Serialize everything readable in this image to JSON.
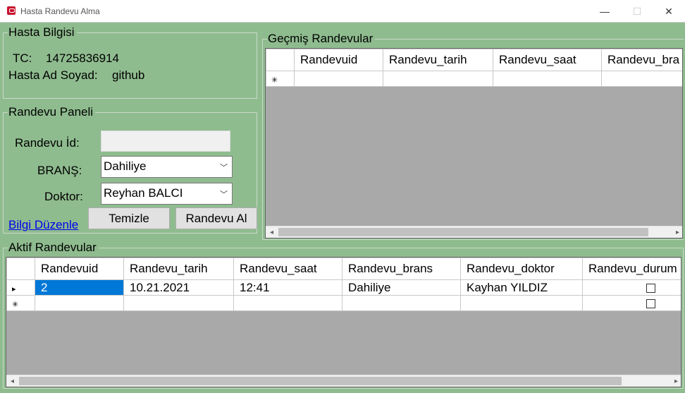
{
  "window": {
    "title": "Hasta Randevu Alma",
    "minimize": "—",
    "maximize": "☐",
    "close": "✕"
  },
  "patient_info": {
    "group_title": "Hasta Bilgisi",
    "tc_label": "TC:",
    "tc_value": "14725836914",
    "name_label": "Hasta Ad Soyad:",
    "name_value": "github"
  },
  "appointment_panel": {
    "group_title": "Randevu Paneli",
    "id_label": "Randevu İd:",
    "id_value": "",
    "branch_label": "BRANŞ:",
    "branch_selected": "Dahiliye",
    "doctor_label": "Doktor:",
    "doctor_selected": "Reyhan BALCI",
    "clear_button": "Temizle",
    "book_button": "Randevu Al",
    "edit_link": "Bilgi Düzenle"
  },
  "past_appointments": {
    "group_title": "Geçmiş Randevular",
    "columns": [
      "Randevuid",
      "Randevu_tarih",
      "Randevu_saat",
      "Randevu_bra"
    ],
    "new_row_marker": "✳"
  },
  "active_appointments": {
    "group_title": "Aktif Randevular",
    "columns": [
      "Randevuid",
      "Randevu_tarih",
      "Randevu_saat",
      "Randevu_brans",
      "Randevu_doktor",
      "Randevu_durum"
    ],
    "rows": [
      {
        "marker": "▸",
        "Randevuid": "2",
        "Randevu_tarih": "10.21.2021",
        "Randevu_saat": "12:41",
        "Randevu_brans": "Dahiliye",
        "Randevu_doktor": "Kayhan YILDIZ",
        "Randevu_durum": false
      }
    ],
    "new_row_marker": "✳"
  },
  "icons": {
    "app": "app-calendar-icon",
    "dropdown": "chevron-down-icon",
    "scroll_left": "◂",
    "scroll_right": "▸"
  },
  "colors": {
    "form_background": "#8fbc8f",
    "grid_background": "#a9a9a9",
    "selection": "#0078d7",
    "link": "#0000ee"
  }
}
